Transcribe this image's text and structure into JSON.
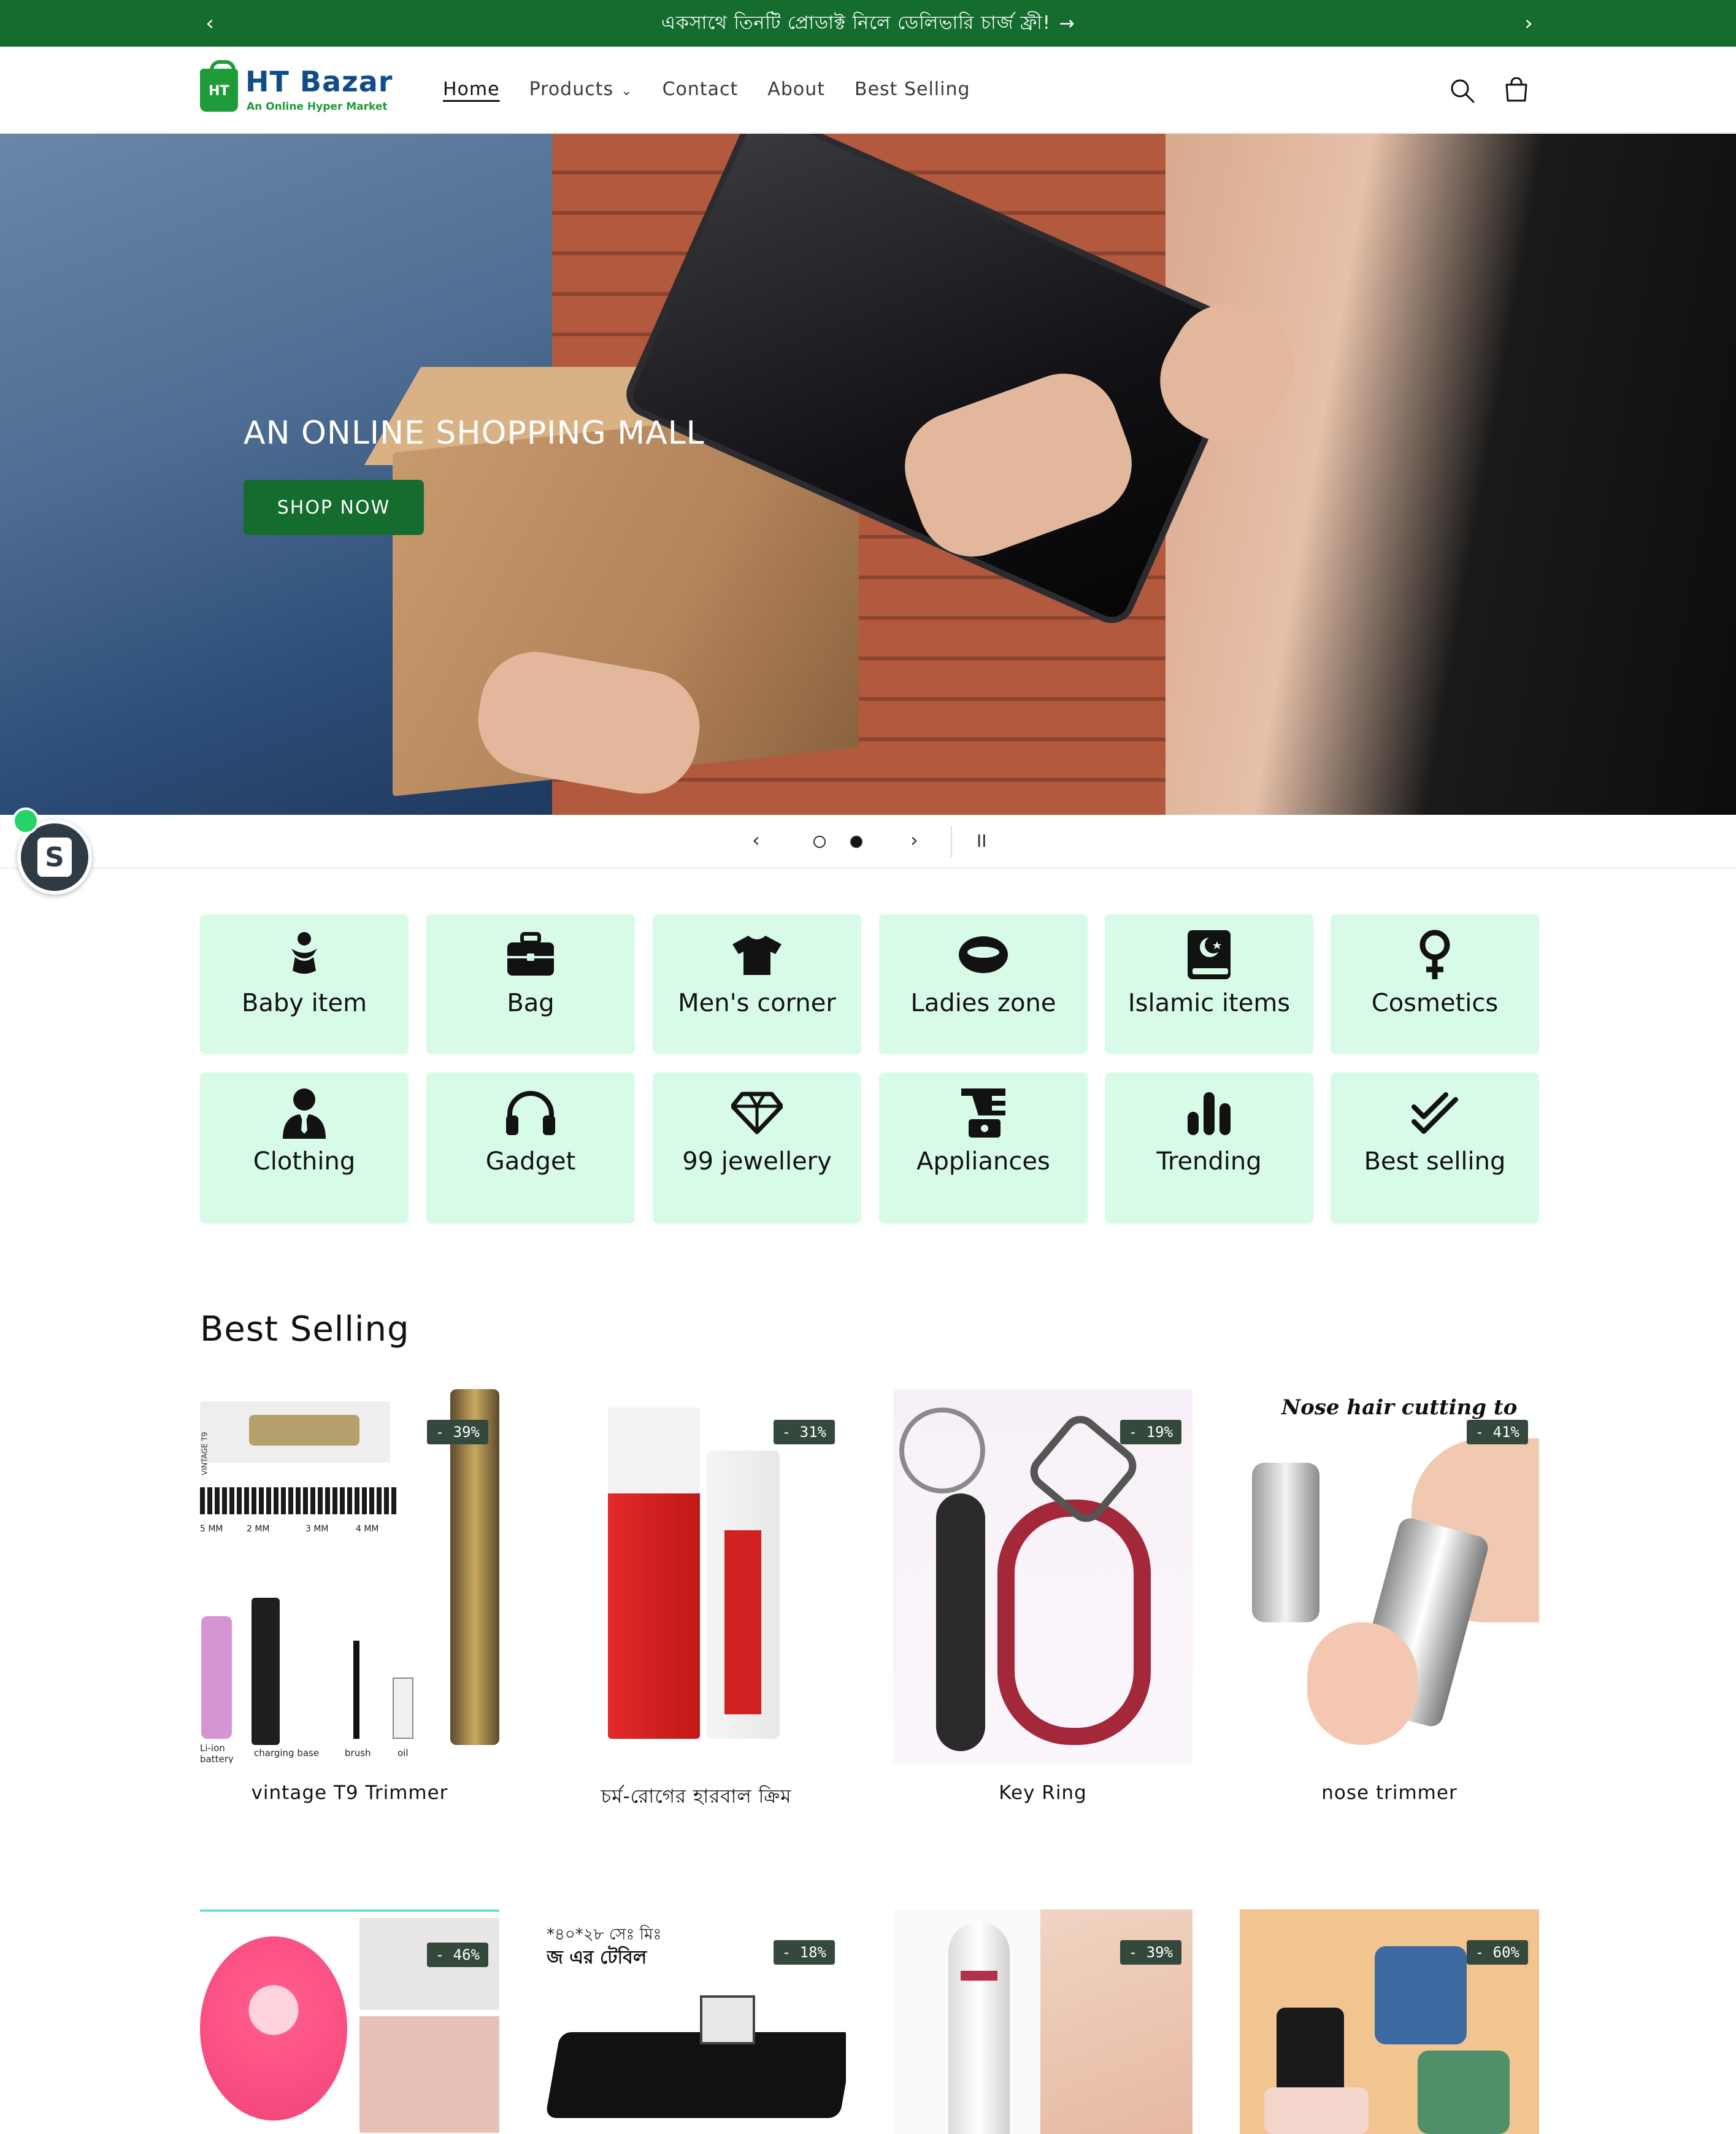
{
  "announcement": {
    "text": "একসাথে তিনটি প্রোডাক্ট নিলে ডেলিভারি চার্জ ফ্রী!",
    "arrow": "→",
    "prev": "‹",
    "next": "›"
  },
  "brand": {
    "name": "HT Bazar",
    "tagline": "An Online Hyper Market",
    "bag_letters": "HT"
  },
  "nav": {
    "items": [
      "Home",
      "Products",
      "Contact",
      "About",
      "Best Selling"
    ],
    "products_chevron": "⌄"
  },
  "hero": {
    "title": "AN ONLINE SHOPPING MALL",
    "button": "SHOP NOW"
  },
  "slider": {
    "prev": "‹",
    "next": "›",
    "pause": "II",
    "active_slide": 2,
    "total_slides": 2
  },
  "shopify": {
    "letter": "S"
  },
  "categories": [
    {
      "label": "Baby item",
      "icon": "baby-icon"
    },
    {
      "label": "Bag",
      "icon": "briefcase-icon"
    },
    {
      "label": "Men's corner",
      "icon": "tshirt-icon"
    },
    {
      "label": "Ladies zone",
      "icon": "ring-icon"
    },
    {
      "label": "Islamic items",
      "icon": "quran-icon"
    },
    {
      "label": "Cosmetics",
      "icon": "venus-icon"
    },
    {
      "label": "Clothing",
      "icon": "user-tie-icon"
    },
    {
      "label": "Gadget",
      "icon": "headphones-icon"
    },
    {
      "label": "99 jewellery",
      "icon": "gem-icon"
    },
    {
      "label": "Appliances",
      "icon": "blender-icon"
    },
    {
      "label": "Trending",
      "icon": "bar-chart-icon"
    },
    {
      "label": "Best selling",
      "icon": "double-check-icon"
    }
  ],
  "best_selling": {
    "title": "Best Selling",
    "products": [
      {
        "name": "vintage T9 Trimmer",
        "discount": "- 39%",
        "old_price": "",
        "price": "",
        "image_text_1": "VINTAGE T9",
        "image_text_2": "charging base",
        "image_text_3": "brush",
        "image_text_4": "oil",
        "image_text_5": "Li-ion battery",
        "image_text_6": "5 MM",
        "image_text_7": "2 MM",
        "image_text_8": "3 MM",
        "image_text_9": "4 MM"
      },
      {
        "name": "চর্ম-রোগের হারবাল ক্রিম",
        "discount": "- 31%",
        "old_price": "",
        "price": ""
      },
      {
        "name": "Key Ring",
        "discount": "- 19%",
        "old_price": "",
        "price": ""
      },
      {
        "name": "nose trimmer",
        "discount": "- 41%",
        "old_price": "",
        "price": "",
        "image_text_1": "Nose hair cutting to"
      },
      {
        "name": "",
        "discount": "- 46%"
      },
      {
        "name": "",
        "discount": "- 18%",
        "image_text_1": "*৪০*২৮ সেঃ মিঃ",
        "image_text_2": "জ এর টেবিল"
      },
      {
        "name": "",
        "discount": "- 39%"
      },
      {
        "name": "",
        "discount": "- 60%"
      }
    ]
  },
  "colors": {
    "primary_green": "#146c2e",
    "category_bg": "#d8fbe8",
    "badge_bg": "#34493b"
  }
}
